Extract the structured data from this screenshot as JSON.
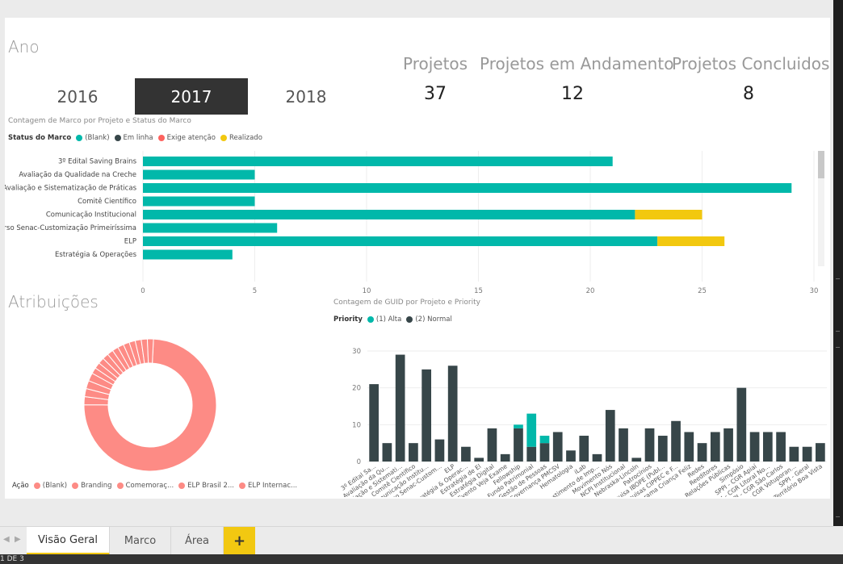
{
  "filters": {
    "title": "Ano",
    "years": [
      "2016",
      "2017",
      "2018"
    ],
    "selected": "2017"
  },
  "kpis": [
    {
      "label": "Projetos",
      "value": "37"
    },
    {
      "label": "Projetos em Andamento",
      "value": "12"
    },
    {
      "label": "Projetos Concluidos",
      "value": "8"
    }
  ],
  "colors": {
    "blank": "#01b8aa",
    "em_linha": "#374649",
    "exige": "#fd625e",
    "realizado": "#f2c80f",
    "normal": "#374649",
    "alta": "#01b8aa",
    "donut": "#fd8b85"
  },
  "marco_chart": {
    "title": "Contagem de Marco por Projeto e Status do Marco",
    "legend_title": "Status do Marco",
    "legend": [
      "(Blank)",
      "Em linha",
      "Exige atenção",
      "Realizado"
    ]
  },
  "atrib": {
    "title": "Atribuições",
    "legend_title": "Ação",
    "legend": [
      "(Blank)",
      "Branding",
      "Comemoraç...",
      "ELP Brasil 2...",
      "ELP Internac..."
    ]
  },
  "guid_chart": {
    "title": "Contagem de GUID por Projeto e Priority",
    "legend_title": "Priority",
    "legend": [
      "(1) Alta",
      "(2) Normal"
    ]
  },
  "chart_data": [
    {
      "type": "bar",
      "orientation": "horizontal",
      "stacked": true,
      "title": "Contagem de Marco por Projeto e Status do Marco",
      "categories": [
        "3º Edital Saving Brains",
        "Avaliação da Qualidade na Creche",
        "Avaliação e Sistematização de Práticas",
        "Comitê Científico",
        "Comunicação Institucional",
        "Curso Senac-Customização Primeiríssima",
        "ELP",
        "Estratégia & Operações"
      ],
      "series": [
        {
          "name": "(Blank)",
          "values": [
            21,
            5,
            29,
            5,
            22,
            6,
            23,
            4
          ]
        },
        {
          "name": "Realizado",
          "values": [
            0,
            0,
            0,
            0,
            3,
            0,
            3,
            0
          ]
        }
      ],
      "xticks": [
        "0",
        "5",
        "10",
        "15",
        "20",
        "25",
        "30"
      ],
      "xlim": [
        0,
        30
      ],
      "grid": true,
      "legend_position": "top-left"
    },
    {
      "type": "pie",
      "donut": true,
      "title": "Atribuições",
      "labels": [
        "(Blank)",
        "Branding",
        "Comemoraç...",
        "ELP Brasil 2...",
        "ELP Internac...",
        "",
        "",
        "",
        "",
        "",
        "",
        "",
        "",
        "",
        "",
        "",
        ""
      ],
      "values": [
        75,
        2,
        2,
        2,
        2,
        1.5,
        1.5,
        1.5,
        1.5,
        1.5,
        1.5,
        1.5,
        1.5,
        1.5,
        1.5,
        1.5,
        1.5
      ],
      "legend_position": "bottom"
    },
    {
      "type": "bar",
      "stacked": true,
      "title": "Contagem de GUID por Projeto e Priority",
      "categories": [
        "3º Edital Sa...",
        "Avaliação da Qu...",
        "Avaliação e Sistemati...",
        "Comitê Científico",
        "Comunicação Institu...",
        "Curso Senac-Custom...",
        "ELP",
        "Estratégia & Operac...",
        "Estratégia de El",
        "Estratégia Digital",
        "Evento Veja Exame",
        "Fellowship",
        "Fundo Patrimonial",
        "Gestão de Pessoas",
        "Governança PMCSV",
        "Hematologia",
        "iLab",
        "Investimento de Imp...",
        "Movimento Nós",
        "NCPI Institucional",
        "Nebraska-Lincoln",
        "Patrocínios",
        "Pesquisa IBOPE (Publ...",
        "Pesquisas CIPPEC e F...",
        "Programa Criança Feliz",
        "Redes",
        "Reeditores",
        "Relações Públicas",
        "Simpósio",
        "SPPI - CGR Apiaí",
        "SPPI - CGR Litoral No...",
        "SPPI - CGR São Carlos",
        "SPPI - CGR Votuporan...",
        "SPPI - Geral",
        "Território Boa Vista"
      ],
      "series": [
        {
          "name": "(2) Normal",
          "values": [
            21,
            5,
            29,
            5,
            25,
            6,
            26,
            4,
            1,
            9,
            2,
            9,
            4,
            5,
            8,
            3,
            7,
            2,
            14,
            9,
            1,
            9,
            7,
            11,
            8,
            5,
            8,
            9,
            20,
            8,
            8,
            8,
            4,
            4,
            5
          ]
        },
        {
          "name": "(1) Alta",
          "values": [
            0,
            0,
            0,
            0,
            0,
            0,
            0,
            0,
            0,
            0,
            0,
            1,
            9,
            2,
            0,
            0,
            0,
            0,
            0,
            0,
            0,
            0,
            0,
            0,
            0,
            0,
            0,
            0,
            0,
            0,
            0,
            0,
            0,
            0,
            0
          ]
        }
      ],
      "yticks": [
        "0",
        "10",
        "20",
        "30"
      ],
      "ylim": [
        0,
        30
      ],
      "legend_position": "top-left"
    }
  ],
  "tabs": {
    "items": [
      "Visão Geral",
      "Marco",
      "Área"
    ],
    "active": "Visão Geral",
    "add_label": "+"
  },
  "status": {
    "page": "1 DE 3"
  }
}
